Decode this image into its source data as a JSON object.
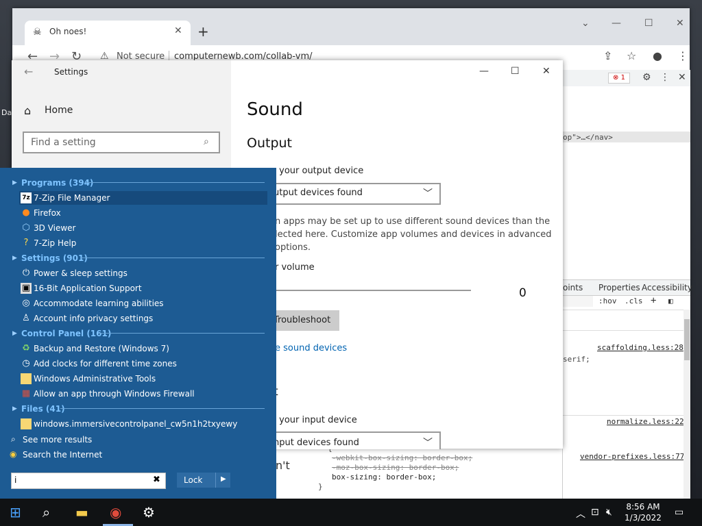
{
  "desktop": {
    "edge_label": "Da"
  },
  "chrome": {
    "tab_title": "Oh noes!",
    "security_label": "Not secure",
    "url": "computernewb.com/collab-vm/",
    "devtools": {
      "error_count": "1",
      "nav_fragment": "op\">…</nav>",
      "panel_tabs": [
        "oints",
        "Properties",
        "Accessibility"
      ],
      "hov": ":hov",
      "cls": ".cls",
      "rules": [
        {
          "source": "scaffolding.less:28",
          "line": "serif;"
        },
        {
          "source": "normalize.less:22",
          "line": ""
        },
        {
          "source": "vendor-prefixes.less:77",
          "line": ""
        }
      ],
      "code_lines": [
        "{",
        "-webkit-box-sizing: border-box;",
        "-moz-box-sizing: border-box;",
        "box-sizing: border-box;",
        "}"
      ]
    },
    "behind_text": "n't"
  },
  "settings": {
    "title": "Settings",
    "home": "Home",
    "search_placeholder": "Find a setting",
    "page_title": "Sound",
    "output": {
      "heading": "Output",
      "choose_label": "e your output device",
      "device_value": "utput devices found",
      "desc_lines": [
        "n apps may be set up to use different sound devices than the",
        "lected here. Customize app volumes and devices in advanced",
        "options."
      ],
      "volume_label": "r volume",
      "volume_value": "0",
      "troubleshoot": "Troubleshoot",
      "manage_link": "e sound devices"
    },
    "input": {
      "heading_fragment": "t",
      "choose_label": "e your input device",
      "device_value": "nput devices found"
    }
  },
  "start_menu": {
    "categories": [
      {
        "label": "Programs (394)",
        "items": [
          {
            "label": "7-Zip File Manager",
            "icon": "7zip-icon",
            "selected": true
          },
          {
            "label": "Firefox",
            "icon": "firefox-icon"
          },
          {
            "label": "3D Viewer",
            "icon": "cube-icon"
          },
          {
            "label": "7-Zip Help",
            "icon": "help-icon"
          }
        ]
      },
      {
        "label": "Settings (901)",
        "items": [
          {
            "label": "Power & sleep settings",
            "icon": "power-icon"
          },
          {
            "label": "16-Bit Application Support",
            "icon": "app-icon"
          },
          {
            "label": "Accommodate learning abilities",
            "icon": "ease-of-access-icon"
          },
          {
            "label": "Account info privacy settings",
            "icon": "account-icon"
          }
        ]
      },
      {
        "label": "Control Panel (161)",
        "items": [
          {
            "label": "Backup and Restore (Windows 7)",
            "icon": "backup-icon"
          },
          {
            "label": "Add clocks for different time zones",
            "icon": "clock-icon"
          },
          {
            "label": "Windows Administrative Tools",
            "icon": "folder-icon"
          },
          {
            "label": "Allow an app through Windows Firewall",
            "icon": "firewall-icon"
          }
        ]
      },
      {
        "label": "Files (41)",
        "items": [
          {
            "label": "windows.immersivecontrolpanel_cw5n1h2txyewy",
            "icon": "folder-icon"
          }
        ]
      }
    ],
    "see_more": "See more results",
    "search_internet": "Search the Internet",
    "search_value": "i",
    "lock_label": "Lock"
  },
  "taskbar": {
    "time": "8:56 AM",
    "date": "1/3/2022"
  },
  "colors": {
    "start_bg": "#1d5b93",
    "category": "#7ec3ff",
    "link": "#0063b1",
    "taskbar": "#101214"
  }
}
